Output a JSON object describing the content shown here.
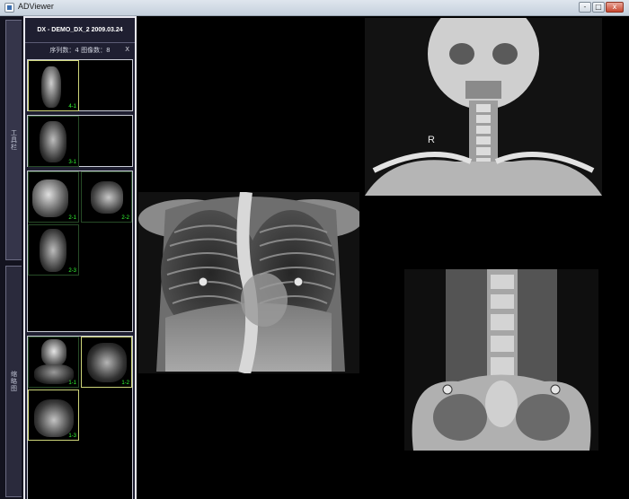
{
  "window": {
    "title": "ADViewer",
    "minimize": "-",
    "maximize": "□",
    "close": "x"
  },
  "rail": {
    "tab_top": "工具栏",
    "tab_bottom": "缩略图"
  },
  "panel": {
    "header": "DX - DEMO_DX_2 2009.03.24",
    "summary": "序列数：4 图像数：8",
    "close_label": "X"
  },
  "groups": [
    {
      "thumbs": [
        {
          "label": "4-1",
          "selected": true
        }
      ]
    },
    {
      "thumbs": [
        {
          "label": "3-1",
          "selected": false
        }
      ]
    },
    {
      "thumbs": [
        {
          "label": "2-1",
          "selected": false
        },
        {
          "label": "2-2",
          "selected": false
        },
        {
          "label": "2-3",
          "selected": false
        }
      ]
    },
    {
      "thumbs": [
        {
          "label": "1-1",
          "selected": false
        },
        {
          "label": "1-2",
          "selected": true
        },
        {
          "label": "1-3",
          "selected": false
        }
      ]
    }
  ],
  "viewer": {
    "orientation_marker": "R"
  },
  "colors": {
    "index_text": "#33ff33",
    "selected_border": "#cfd67a",
    "panel_bg": "#1f1f31"
  }
}
